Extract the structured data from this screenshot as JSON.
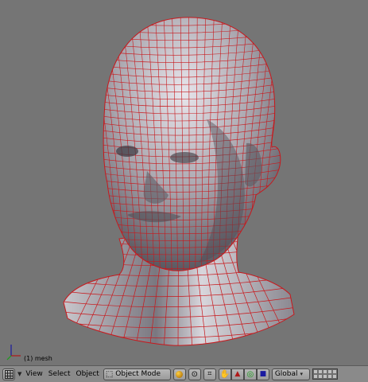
{
  "viewport": {
    "object_label": "(1) mesh",
    "axis_label_z": "z",
    "axis_label_x": "x"
  },
  "header": {
    "menus": [
      "View",
      "Select",
      "Object"
    ],
    "mode_label": "Object Mode",
    "orientation_label": "Global"
  },
  "colors": {
    "viewport_bg": "#757575",
    "wire": "#c8181c",
    "mesh": "#b0acb4",
    "header_bg": "#8a8a8a"
  },
  "icons": [
    "window-type-icon",
    "menu-toggle-icon",
    "object-mode-icon",
    "draw-type-icon",
    "pivot-icon",
    "snap-icon",
    "hand-icon",
    "translate-icon",
    "rotate-icon",
    "scale-icon",
    "layers-icon"
  ]
}
